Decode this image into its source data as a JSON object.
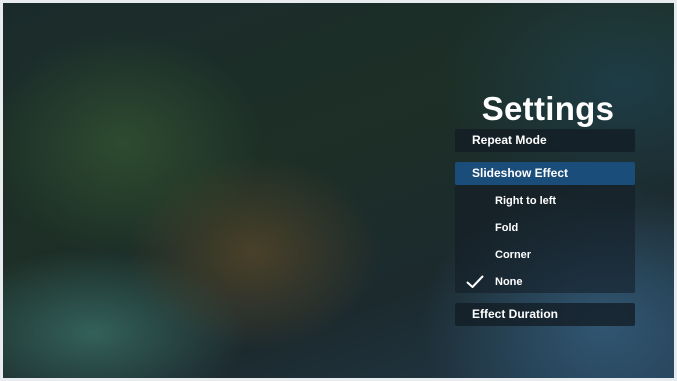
{
  "settings": {
    "title": "Settings",
    "menu": {
      "repeat_mode": "Repeat Mode",
      "slideshow_effect": "Slideshow Effect",
      "effect_duration": "Effect Duration"
    },
    "slideshow_options": [
      {
        "label": "Right to left",
        "checked": false
      },
      {
        "label": "Fold",
        "checked": false
      },
      {
        "label": "Corner",
        "checked": false
      },
      {
        "label": "None",
        "checked": true
      }
    ],
    "selected_icon": "checkmark-icon"
  }
}
